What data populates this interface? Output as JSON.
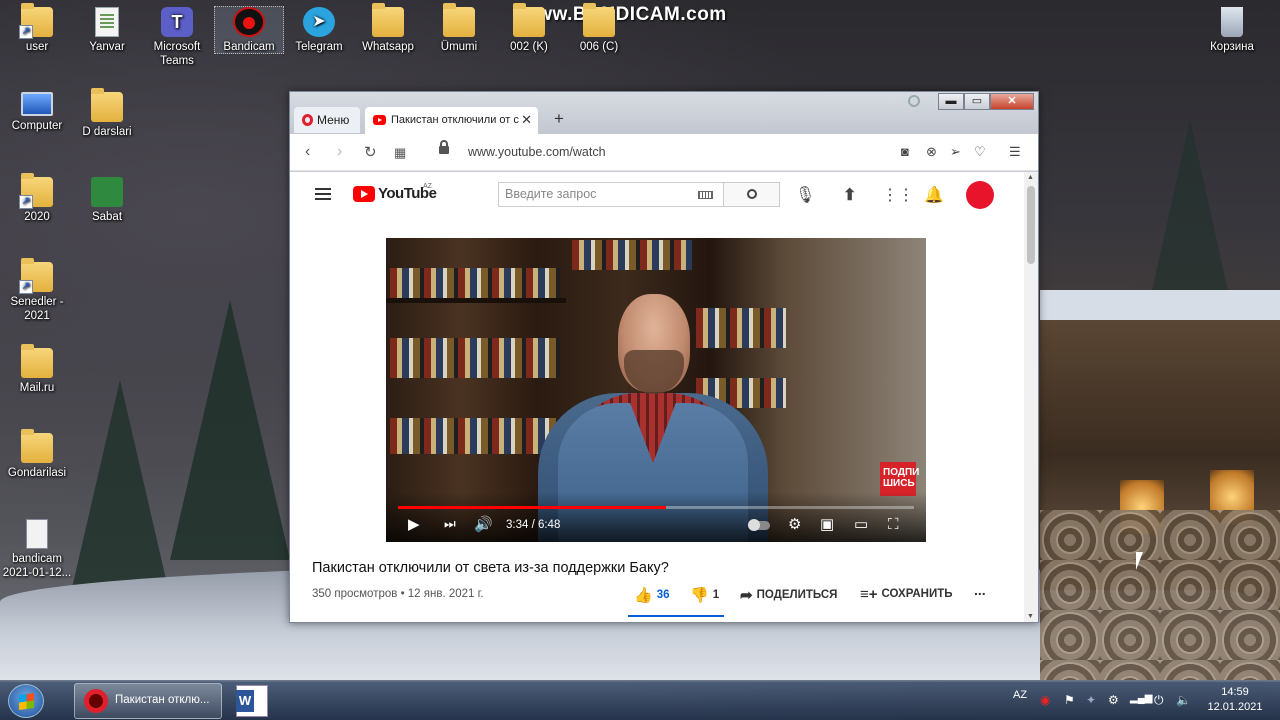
{
  "watermark": "www.BANDICAM.com",
  "desktop": {
    "icons": [
      {
        "label": "user"
      },
      {
        "label": "Yanvar"
      },
      {
        "label": "Microsoft Teams"
      },
      {
        "label": "Bandicam"
      },
      {
        "label": "Telegram"
      },
      {
        "label": "Whatsapp"
      },
      {
        "label": "Ümumi"
      },
      {
        "label": "002 (K)"
      },
      {
        "label": "006 (C)"
      },
      {
        "label": "Корзина"
      },
      {
        "label": "Computer"
      },
      {
        "label": "D darslari"
      },
      {
        "label": "2020"
      },
      {
        "label": "Sabat"
      },
      {
        "label": "Senedler - 2021"
      },
      {
        "label": "Mail.ru"
      },
      {
        "label": "Gondarilasi"
      },
      {
        "label": "bandicam 2021-01-12..."
      }
    ]
  },
  "browser": {
    "menu_label": "Меню",
    "tab_title": "Пакистан отключили от света из-за поддержки Баку?",
    "new_tab_symbol": "+",
    "tab_close_symbol": "✕",
    "url": "www.youtube.com/watch",
    "window_controls": {
      "minimize": "▬",
      "maximize": "▭",
      "close": "✕"
    }
  },
  "youtube": {
    "logo_text": "YouTube",
    "country": "AZ",
    "search_placeholder": "Введите запрос",
    "player": {
      "current_time": "3:34",
      "duration": "6:48",
      "time_display": "3:34 / 6:48",
      "progress": 0.52,
      "subscribe_badge": "ПОДПИ ШИСЬ"
    },
    "video": {
      "title": "Пакистан отключили от света из-за поддержки Баку?",
      "meta": "350 просмотров • 12 янв. 2021 г.",
      "likes": "36",
      "dislikes": "1",
      "share_label": "ПОДЕЛИТЬСЯ",
      "save_label": "СОХРАНИТЬ",
      "more_label": "..."
    }
  },
  "taskbar": {
    "opera_task_label": "Пакистан отклю...",
    "language": "AZ",
    "time": "14:59",
    "date": "12.01.2021"
  }
}
